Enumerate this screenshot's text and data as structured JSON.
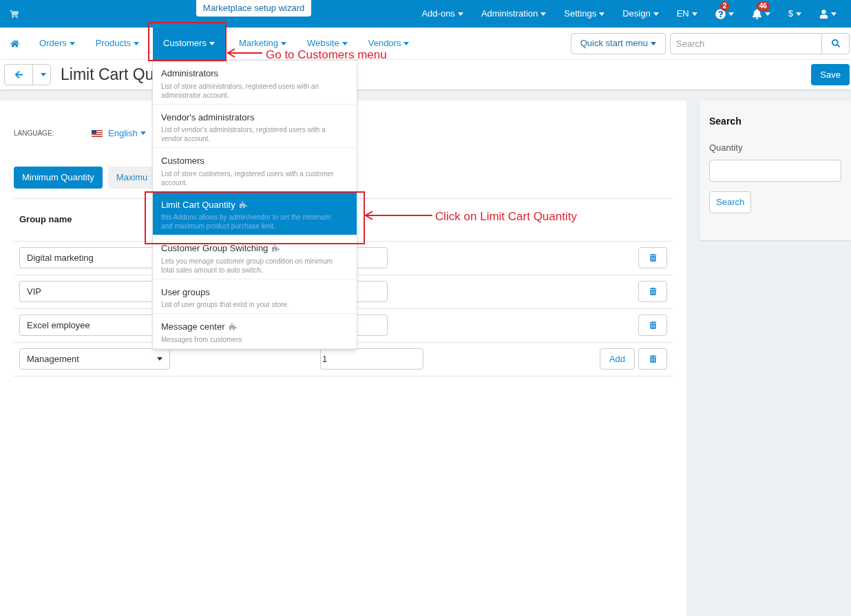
{
  "top_bar": {
    "wizard": "Marketplace setup wizard",
    "menus": [
      {
        "kind": "text",
        "label": "Add-ons"
      },
      {
        "kind": "text",
        "label": "Administration"
      },
      {
        "kind": "text",
        "label": "Settings"
      },
      {
        "kind": "text",
        "label": "Design"
      },
      {
        "kind": "text",
        "label": "EN"
      },
      {
        "kind": "help",
        "badge": "2"
      },
      {
        "kind": "bell",
        "badge": "46"
      },
      {
        "kind": "text",
        "label": "$"
      },
      {
        "kind": "user"
      }
    ]
  },
  "nav": {
    "items": [
      {
        "label": "Orders",
        "selected": false
      },
      {
        "label": "Products",
        "selected": false
      },
      {
        "label": "Customers",
        "selected": true
      },
      {
        "label": "Marketing",
        "selected": false
      },
      {
        "label": "Website",
        "selected": false
      },
      {
        "label": "Vendors",
        "selected": false
      }
    ],
    "quick_start": "Quick start menu",
    "search": {
      "placeholder": "Search"
    }
  },
  "title_bar": {
    "title": "Limit Cart Qu",
    "save": "Save"
  },
  "language": {
    "label": "LANGUAGE:",
    "value": "English"
  },
  "tabs": [
    {
      "label": "Minimum Quantity",
      "selected": true
    },
    {
      "label": "Maximu",
      "selected": false
    }
  ],
  "table": {
    "header": "Group name",
    "rows": [
      {
        "group": "Digital marketing"
      },
      {
        "group": "VIP"
      },
      {
        "group": "Excel employee"
      },
      {
        "group": "Management",
        "quantity": "1",
        "add_button": "Add"
      }
    ]
  },
  "search_panel": {
    "title": "Search",
    "field_label": "Quantity",
    "button": "Search"
  },
  "customers_menu": [
    {
      "title": "Administrators",
      "description": "List of store administrators, registered users with an administrator account.",
      "addon": false,
      "selected": false
    },
    {
      "title": "Vendor's administrators",
      "description": "List of vendor's administrators, registered users with a vendor account.",
      "addon": false,
      "selected": false
    },
    {
      "title": "Customers",
      "description": "List of store customers, registered users with a customer account.",
      "addon": false,
      "selected": false
    },
    {
      "title": "Limit Cart Quantity",
      "description": "this Addons allows by admin/vendor to set the minimum and maximum product purchase limit.",
      "addon": true,
      "selected": true
    },
    {
      "title": "Customer Group Switching",
      "description": "Lets you menage customer group condition on minimum total sales amount to auto switch.",
      "addon": true,
      "selected": false
    },
    {
      "title": "User groups",
      "description": "List of user groups that exist in your store.",
      "addon": false,
      "selected": false
    },
    {
      "title": "Message center",
      "description": "Messages from customers",
      "addon": true,
      "selected": false
    }
  ],
  "annotations": [
    "Go to Customers menu",
    "Click on Limit Cart Quantity"
  ]
}
